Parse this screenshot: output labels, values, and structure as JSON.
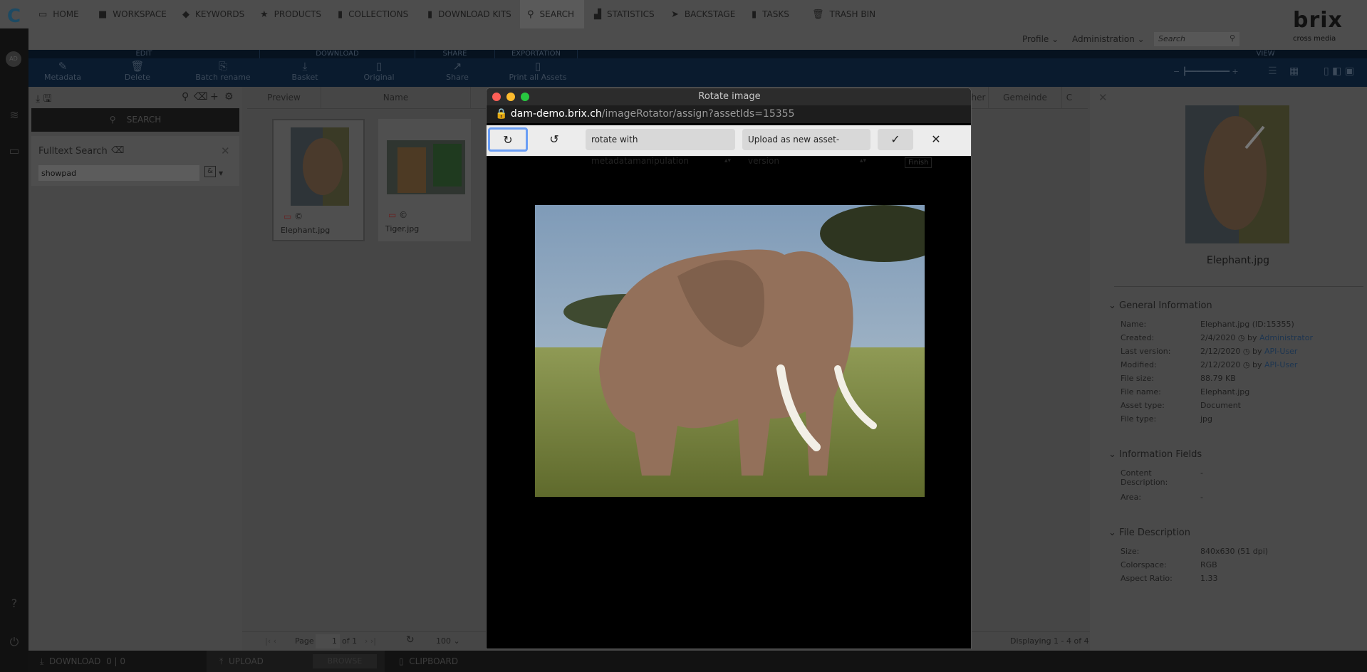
{
  "nav": {
    "items": [
      {
        "label": "HOME",
        "icon": "monitor-icon"
      },
      {
        "label": "WORKSPACE",
        "icon": "folder-icon"
      },
      {
        "label": "KEYWORDS",
        "icon": "tag-icon"
      },
      {
        "label": "PRODUCTS",
        "icon": "star-icon"
      },
      {
        "label": "COLLECTIONS",
        "icon": "briefcase-icon"
      },
      {
        "label": "DOWNLOAD KITS",
        "icon": "briefcase-icon"
      },
      {
        "label": "SEARCH",
        "icon": "search-icon",
        "active": true
      },
      {
        "label": "STATISTICS",
        "icon": "bar-chart-icon"
      },
      {
        "label": "BACKSTAGE",
        "icon": "location-arrow-icon"
      },
      {
        "label": "TASKS",
        "icon": "clipboard-icon"
      },
      {
        "label": "TRASH BIN",
        "icon": "trash-icon"
      }
    ],
    "profile": "Profile",
    "administration": "Administration",
    "search_placeholder": "Search",
    "brand": "brix",
    "brand_sub": "cross media",
    "avatar": "AD"
  },
  "ribbon": {
    "sections": [
      "EDIT",
      "DOWNLOAD",
      "SHARE",
      "EXPORTATION",
      "VIEW"
    ],
    "buttons": [
      "Metadata",
      "Delete",
      "Batch rename",
      "Basket",
      "Original",
      "Share",
      "Print all Assets"
    ]
  },
  "left": {
    "search_button": "SEARCH",
    "fulltext_title": "Fulltext Search",
    "fulltext_value": "showpad",
    "operator": "&"
  },
  "grid": {
    "columns": [
      "Preview",
      "Name",
      "her",
      "Gemeinde",
      "C"
    ],
    "assets": [
      {
        "name": "Elephant.jpg"
      },
      {
        "name": "Tiger.jpg"
      }
    ],
    "pager": {
      "page_label": "Page",
      "page": "1",
      "of": "of 1",
      "page_size": "100",
      "displaying": "Displaying 1 - 4 of 4"
    }
  },
  "modal": {
    "title": "Rotate image",
    "url_host": "dam-demo.brix.ch",
    "url_path": "/imageRotator/assign?assetIds=15355",
    "rotate_mode": "rotate with metadatamanipulation",
    "upload_mode": "Upload as new asset-version",
    "finish": "Finish"
  },
  "detail": {
    "filename": "Elephant.jpg",
    "sections": [
      {
        "title": "General Information",
        "rows": [
          {
            "k": "Name:",
            "v": "Elephant.jpg (ID:15355)"
          },
          {
            "k": "Created:",
            "v": "2/4/2020",
            "by": "Administrator"
          },
          {
            "k": "Last version:",
            "v": "2/12/2020",
            "by": "API-User"
          },
          {
            "k": "Modified:",
            "v": "2/12/2020",
            "by": "API-User"
          },
          {
            "k": "File size:",
            "v": "88.79 KB"
          },
          {
            "k": "File name:",
            "v": "Elephant.jpg"
          },
          {
            "k": "Asset type:",
            "v": "Document"
          },
          {
            "k": "File type:",
            "v": "jpg"
          }
        ]
      },
      {
        "title": "Information Fields",
        "rows": [
          {
            "k": "Content Description:",
            "v": "-"
          },
          {
            "k": "Area:",
            "v": "-"
          }
        ]
      },
      {
        "title": "File Description",
        "rows": [
          {
            "k": "Size:",
            "v": "840x630 (51 dpi)"
          },
          {
            "k": "Colorspace:",
            "v": "RGB"
          },
          {
            "k": "Aspect Ratio:",
            "v": "1.33"
          }
        ]
      }
    ],
    "by": "by"
  },
  "bottom": {
    "download": "DOWNLOAD",
    "download_count": "0 | 0",
    "upload": "UPLOAD",
    "browse": "BROWSE",
    "clipboard": "CLIPBOARD"
  }
}
